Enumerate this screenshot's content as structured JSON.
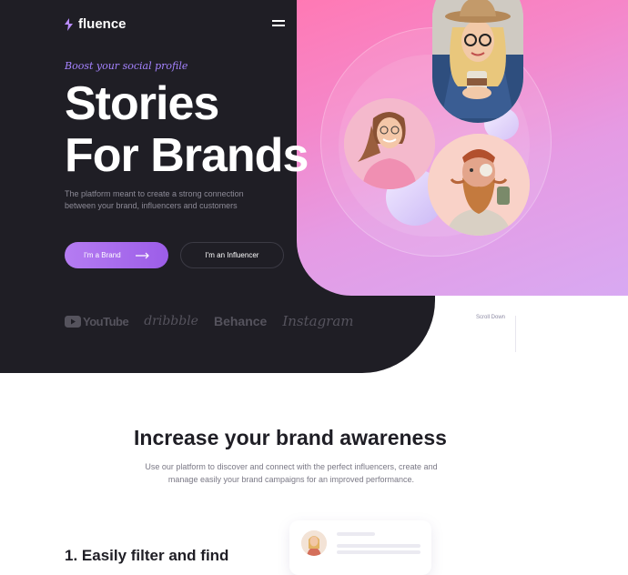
{
  "brand": {
    "name": "fluence",
    "logo_icon": "flame-logo-icon",
    "accent": "#9c5de8"
  },
  "nav": {
    "menu_icon": "hamburger-menu-icon"
  },
  "hero": {
    "tagline": "Boost your social profile",
    "title_line1": "Stories",
    "title_line2": "For Brands",
    "description": "The platform meant to create a strong connection between your brand, influencers and customers",
    "primary_button": "I'm a Brand",
    "secondary_button": "I'm an Influencer",
    "scroll_label": "Scroll Down"
  },
  "partners": {
    "youtube": "YouTube",
    "dribbble": "dribbble",
    "behance": "Behance",
    "instagram": "Instagram"
  },
  "section": {
    "title": "Increase your brand awareness",
    "description": "Use our platform to discover and connect with the perfect influencers, create and manage easily your brand campaigns for an improved performance."
  },
  "feature": {
    "title": "1. Easily filter and find"
  },
  "colors": {
    "dark": "#1f1e25",
    "pink": "#ff79b4",
    "lavender": "#d8a9f2",
    "purple": "#9c5de8"
  }
}
